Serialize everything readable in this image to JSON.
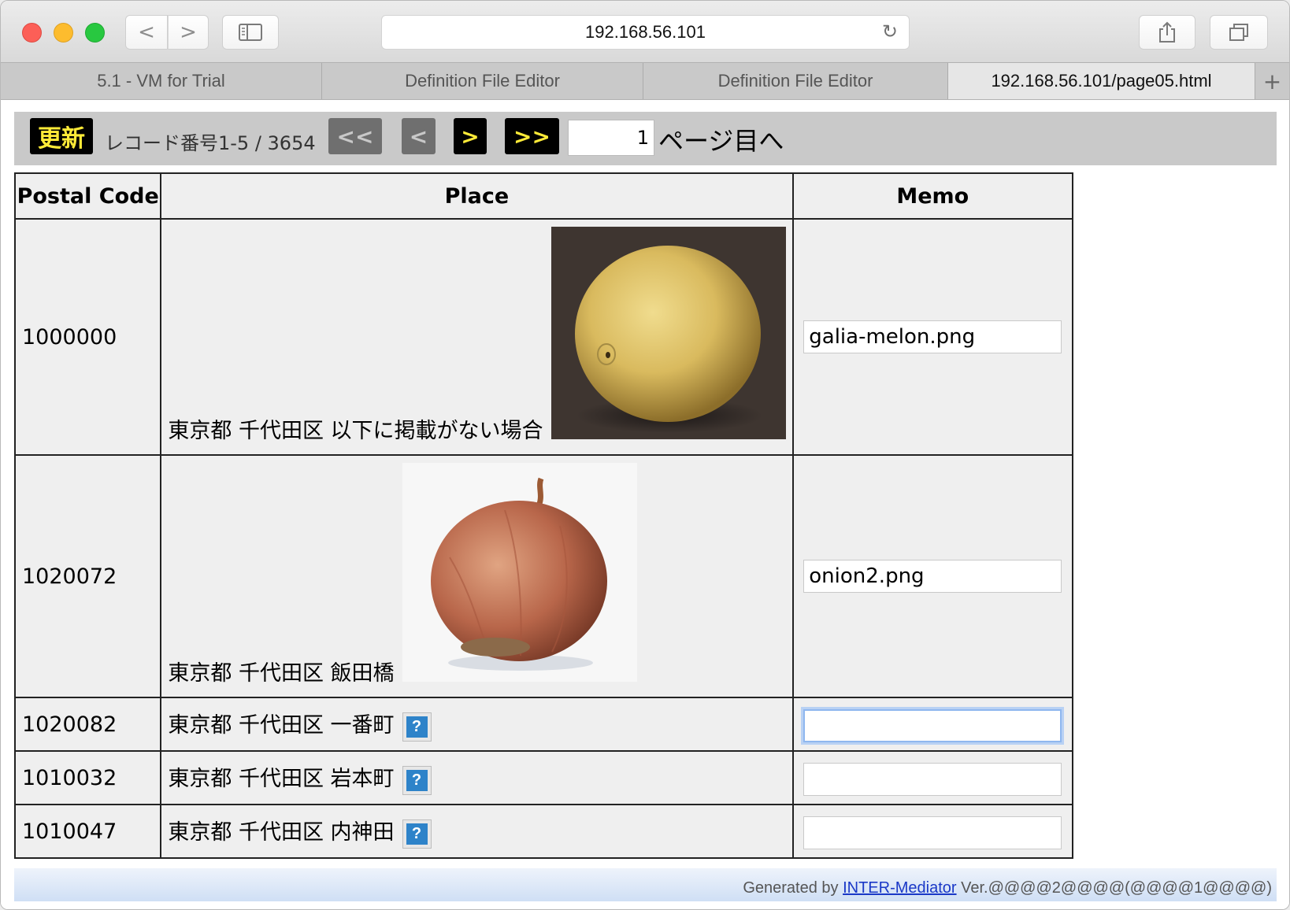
{
  "browser": {
    "url": "192.168.56.101",
    "back_label": "<",
    "forward_label": ">",
    "tabs": [
      {
        "label": "5.1 - VM for Trial"
      },
      {
        "label": "Definition File Editor"
      },
      {
        "label": "Definition File Editor"
      },
      {
        "label": "192.168.56.101/page05.html"
      }
    ],
    "new_tab_label": "+"
  },
  "navigation": {
    "update_label": "更新",
    "record_info": "レコード番号1-5 / 3654",
    "first_label": "<<",
    "prev_label": "<",
    "next_label": ">",
    "last_label": ">>",
    "page_value": "1",
    "page_suffix": "ページ目へ"
  },
  "table": {
    "headers": [
      "Postal Code",
      "Place",
      "Memo"
    ],
    "rows": [
      {
        "code": "1000000",
        "place": "東京都 千代田区 以下に掲載がない場合",
        "memo": "galia-melon.png"
      },
      {
        "code": "1020072",
        "place": "東京都 千代田区 飯田橋",
        "memo": "onion2.png"
      },
      {
        "code": "1020082",
        "place": "東京都 千代田区 一番町",
        "memo": ""
      },
      {
        "code": "1010032",
        "place": "東京都 千代田区 岩本町",
        "memo": ""
      },
      {
        "code": "1010047",
        "place": "東京都 千代田区 内神田",
        "memo": ""
      }
    ],
    "missing_image_glyph": "?"
  },
  "footer": {
    "prefix": "Generated by ",
    "link": "INTER-Mediator",
    "suffix": " Ver.@@@@2@@@@(@@@@1@@@@)"
  },
  "colors": {
    "nav_highlight": "#ffeb38",
    "nav_disabled": "#6f6f6f",
    "help_icon": "#2e83c9",
    "link": "#1a38c7"
  }
}
